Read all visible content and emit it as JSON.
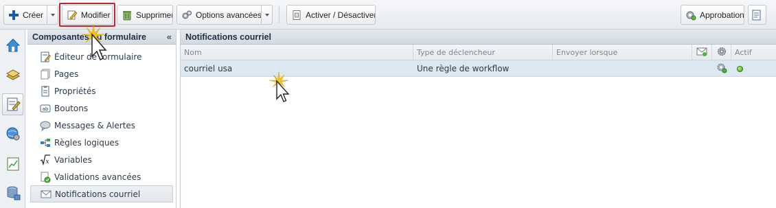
{
  "toolbar": {
    "create_label": "Créer",
    "edit_label": "Modifier",
    "delete_label": "Supprimer",
    "advanced_label": "Options avancées",
    "toggle_label": "Activer / Désactiver",
    "approval_label": "Approbation"
  },
  "rail": {
    "items": [
      "home-icon",
      "stack-icon",
      "form-edit-icon",
      "globe-settings-icon",
      "chart-icon",
      "database-icon"
    ]
  },
  "components": {
    "title": "Composantes du formulaire",
    "collapse_glyph": "«",
    "items": [
      {
        "label": "Éditeur de formulaire",
        "icon": "form-editor-icon"
      },
      {
        "label": "Pages",
        "icon": "pages-icon"
      },
      {
        "label": "Propriétés",
        "icon": "properties-icon"
      },
      {
        "label": "Boutons",
        "icon": "buttons-icon"
      },
      {
        "label": "Messages & Alertes",
        "icon": "speech-bubble-icon"
      },
      {
        "label": "Règles logiques",
        "icon": "logic-rules-icon"
      },
      {
        "label": "Variables",
        "icon": "sqrt-x-icon"
      },
      {
        "label": "Validations avancées",
        "icon": "validation-icon"
      },
      {
        "label": "Notifications courriel",
        "icon": "envelope-icon",
        "selected": true
      }
    ]
  },
  "notifications": {
    "title": "Notifications courriel",
    "columns": {
      "name": "Nom",
      "trigger_type": "Type de déclencheur",
      "send_when": "Envoyer lorsque",
      "active": "Actif"
    },
    "rows": [
      {
        "name": "courriel usa",
        "trigger_type": "Une règle de workflow",
        "send_when": "",
        "active": true
      }
    ]
  },
  "colors": {
    "highlight_box": "#c0272d",
    "selected_row": "#dce7f0",
    "active_dot": "#39a10e"
  }
}
